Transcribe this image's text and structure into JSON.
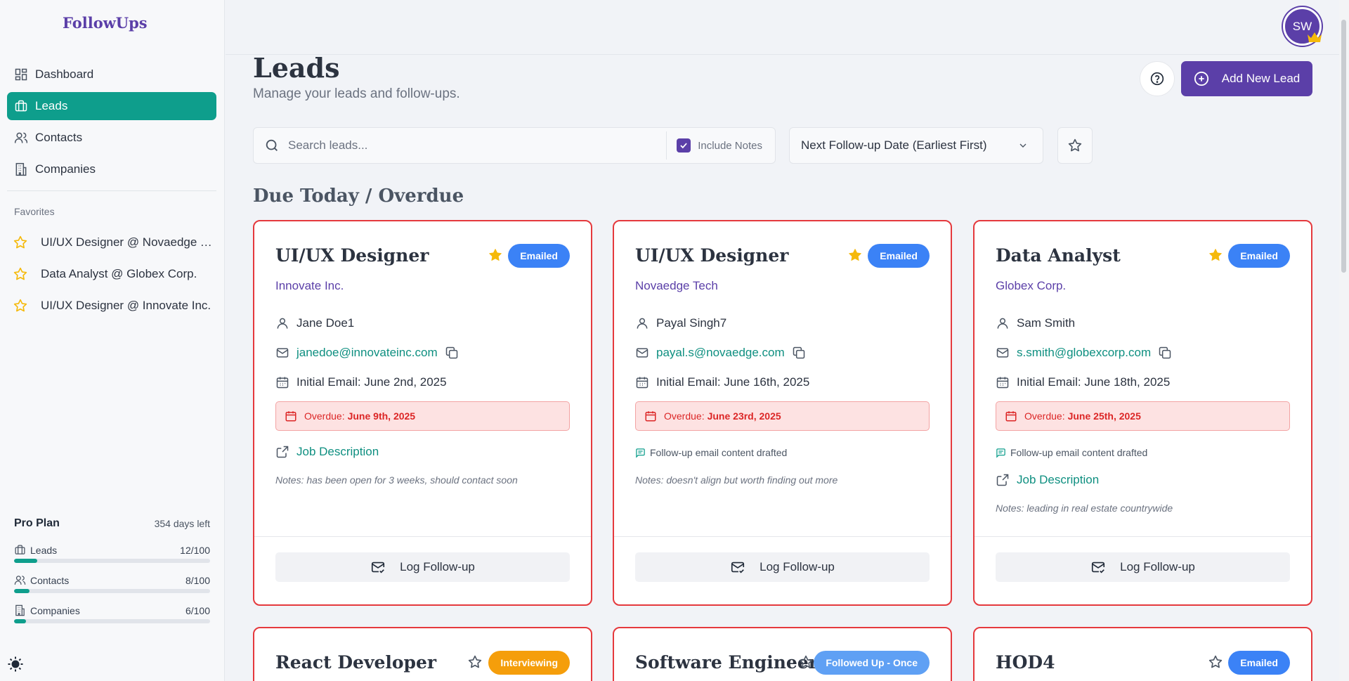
{
  "brand": "FollowUps",
  "nav": [
    {
      "label": "Dashboard",
      "icon": "dashboard-icon"
    },
    {
      "label": "Leads",
      "icon": "briefcase-icon",
      "active": true
    },
    {
      "label": "Contacts",
      "icon": "users-icon"
    },
    {
      "label": "Companies",
      "icon": "building-icon"
    }
  ],
  "favorites": {
    "title": "Favorites",
    "items": [
      "UI/UX Designer @ Novaedge Tech",
      "Data Analyst @ Globex Corp.",
      "UI/UX Designer @ Innovate Inc."
    ]
  },
  "plan": {
    "name": "Pro Plan",
    "days_left": "354 days left",
    "usage": [
      {
        "label": "Leads",
        "count": "12/100",
        "fraction": 0.12
      },
      {
        "label": "Contacts",
        "count": "8/100",
        "fraction": 0.08
      },
      {
        "label": "Companies",
        "count": "6/100",
        "fraction": 0.06
      }
    ]
  },
  "user": {
    "initials": "SW"
  },
  "page": {
    "title": "Leads",
    "subtitle": "Manage your leads and follow-ups.",
    "add_button": "Add New Lead"
  },
  "filters": {
    "search_placeholder": "Search leads...",
    "include_notes": "Include Notes",
    "sort": "Next Follow-up Date (Earliest First)"
  },
  "section_title": "Due Today / Overdue",
  "cards": [
    {
      "title": "UI/UX Designer",
      "status": "Emailed",
      "company": "Innovate Inc.",
      "contact": "Jane Doe1",
      "email": "janedoe@innovateinc.com",
      "initial_email": "Initial Email: June 2nd, 2025",
      "overdue_label": "Overdue:",
      "overdue_date": "June 9th, 2025",
      "job_description": "Job Description",
      "notes": "Notes: has been open for 3 weeks, should contact soon",
      "log_button": "Log Follow-up"
    },
    {
      "title": "UI/UX Designer",
      "status": "Emailed",
      "company": "Novaedge Tech",
      "contact": "Payal Singh7",
      "email": "payal.s@novaedge.com",
      "initial_email": "Initial Email: June 16th, 2025",
      "overdue_label": "Overdue:",
      "overdue_date": "June 23rd, 2025",
      "drafted": "Follow-up email content drafted",
      "notes": "Notes: doesn't align but worth finding out more",
      "log_button": "Log Follow-up"
    },
    {
      "title": "Data Analyst",
      "status": "Emailed",
      "company": "Globex Corp.",
      "contact": "Sam Smith",
      "email": "s.smith@globexcorp.com",
      "initial_email": "Initial Email: June 18th, 2025",
      "overdue_label": "Overdue:",
      "overdue_date": "June 25th, 2025",
      "drafted": "Follow-up email content drafted",
      "job_description": "Job Description",
      "notes": "Notes: leading in real estate countrywide",
      "log_button": "Log Follow-up"
    },
    {
      "title": "React Developer",
      "status": "Interviewing"
    },
    {
      "title": "Software Engineer I",
      "status": "Followed Up - Once"
    },
    {
      "title": "HOD4",
      "status": "Emailed"
    }
  ],
  "colors": {
    "brand": "#5b3fa8",
    "accent": "#0e9e8c",
    "overdue": "#e5393d",
    "star": "#f5b90a"
  }
}
